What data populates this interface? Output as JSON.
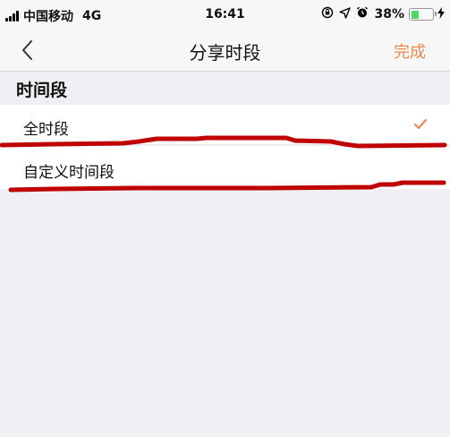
{
  "status_bar": {
    "carrier": "中国移动",
    "network": "4G",
    "time": "16:41",
    "icons": [
      "orientation-lock-icon",
      "location-arrow-icon",
      "alarm-clock-icon"
    ],
    "battery_percent": "38%",
    "battery_level": 0.38,
    "battery_color": "#4cd964"
  },
  "nav": {
    "back_icon": "chevron-left-icon",
    "title": "分享时段",
    "done_label": "完成",
    "accent_color": "#f0894f"
  },
  "section": {
    "header": "时间段",
    "options": [
      {
        "label": "全时段",
        "selected": true
      },
      {
        "label": "自定义时间段",
        "selected": false
      }
    ]
  },
  "annotation_color": "#c00000"
}
